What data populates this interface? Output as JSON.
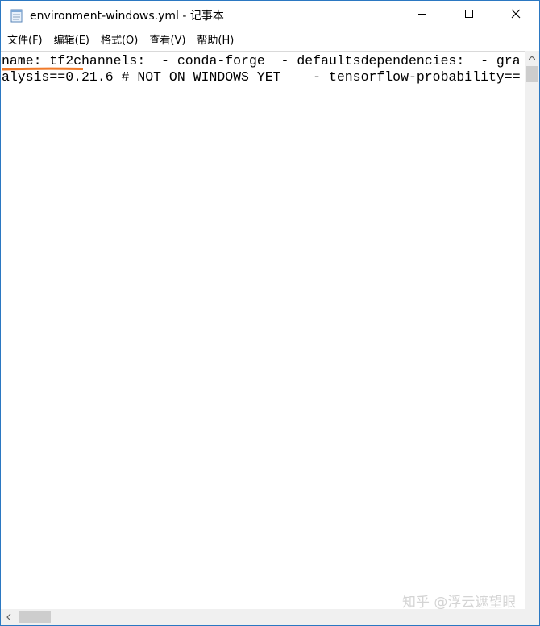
{
  "window": {
    "title": "environment-windows.yml - 记事本"
  },
  "title_buttons": {
    "minimize": "minimize-icon",
    "maximize": "maximize-icon",
    "close": "close-icon"
  },
  "menu": {
    "items": [
      {
        "label": "文件(F)"
      },
      {
        "label": "编辑(E)"
      },
      {
        "label": "格式(O)"
      },
      {
        "label": "查看(V)"
      },
      {
        "label": "帮助(H)"
      }
    ]
  },
  "editor": {
    "lines": [
      "name: tf2channels:  - conda-forge  - defaultsdependencies:  - gra",
      "alysis==0.21.6 # NOT ON WINDOWS YET    - tensorflow-probability=="
    ]
  },
  "annotation": {
    "color": "#f07a2a"
  },
  "watermark": {
    "text": "知乎 @浮云遮望眼"
  },
  "colors": {
    "window_border": "#2b78c2",
    "scrollbar_track": "#f0f0f0",
    "scrollbar_thumb": "#cdcdcd"
  }
}
